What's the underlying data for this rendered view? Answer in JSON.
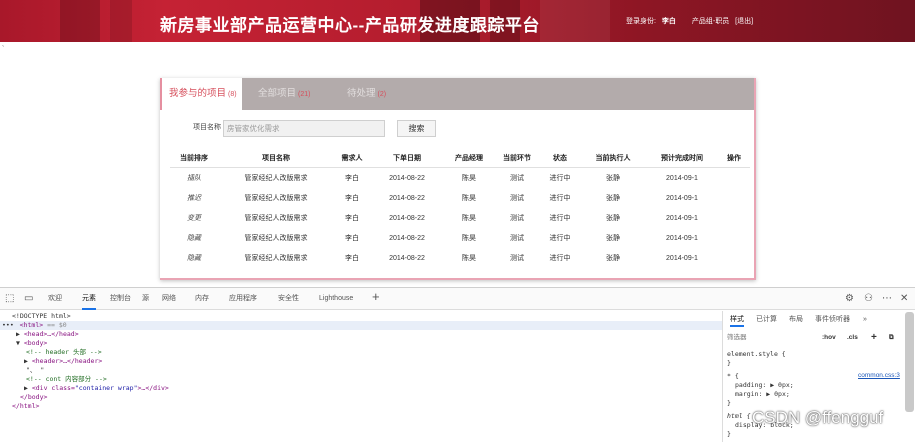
{
  "header": {
    "title": "新房事业部产品运营中心--产品研发进度跟踪平台",
    "login_label": "登录身份:",
    "user_name": "李白",
    "user_group": "产品组-职员",
    "logout": "[退出]"
  },
  "stray_mark": "`",
  "tabs": [
    {
      "label": "我参与的项目",
      "count": "(8)"
    },
    {
      "label": "全部项目",
      "count": "(21)"
    },
    {
      "label": "待处理",
      "count": "(2)"
    }
  ],
  "search": {
    "label": "项目名称",
    "value": "房管家优化需求",
    "button": "搜索"
  },
  "table": {
    "headers": [
      "当前排序",
      "项目名称",
      "需求人",
      "下单日期",
      "产品经理",
      "当前环节",
      "状态",
      "当前执行人",
      "预计完成时间",
      "操作"
    ],
    "rows": [
      [
        "插队",
        "管家经纪人改版需求",
        "李白",
        "2014-08-22",
        "陈昊",
        "测试",
        "进行中",
        "张静",
        "2014-09-1",
        ""
      ],
      [
        "推迟",
        "管家经纪人改版需求",
        "李白",
        "2014-08-22",
        "陈昊",
        "测试",
        "进行中",
        "张静",
        "2014-09-1",
        ""
      ],
      [
        "变更",
        "管家经纪人改版需求",
        "李白",
        "2014-08-22",
        "陈昊",
        "测试",
        "进行中",
        "张静",
        "2014-09-1",
        ""
      ],
      [
        "隐藏",
        "管家经纪人改版需求",
        "李白",
        "2014-08-22",
        "陈昊",
        "测试",
        "进行中",
        "张静",
        "2014-09-1",
        ""
      ],
      [
        "隐藏",
        "管家经纪人改版需求",
        "李白",
        "2014-08-22",
        "陈昊",
        "测试",
        "进行中",
        "张静",
        "2014-09-1",
        ""
      ]
    ]
  },
  "devtools": {
    "tabs": [
      "欢迎",
      "元素",
      "控制台",
      "源",
      "网络",
      "内存",
      "应用程序",
      "安全性",
      "Lighthouse"
    ],
    "elements": {
      "doctype": "<!DOCTYPE html>",
      "html_open": "<html>",
      "html_suffix": "== $0",
      "head": "<head>…</head>",
      "body_open": "<body>",
      "comment_header": "<!--  header 头部  -->",
      "header": "<header>…</header>",
      "text_node": "\"、 \"",
      "comment_cont": "<!-- cont 内容部分  -->",
      "div_open": "<div class=",
      "div_class": "\"container wrap\"",
      "div_close": ">…</div>",
      "body_close": "</body>",
      "html_close": "</html>"
    },
    "styles": {
      "tabs": [
        "样式",
        "已计算",
        "布局",
        "事件侦听器"
      ],
      "filter_placeholder": "筛选器",
      "hov": ":hov",
      "cls": ".cls",
      "rule1": "element.style {",
      "close": "}",
      "rule2": "* {",
      "rule2_link": "common.css:3",
      "padding": "padding: ▶ 0px;",
      "margin": "margin: ▶ 0px;",
      "rule3": "html {",
      "display": "display: block;"
    }
  },
  "watermark": "CSDN @ffengguf"
}
